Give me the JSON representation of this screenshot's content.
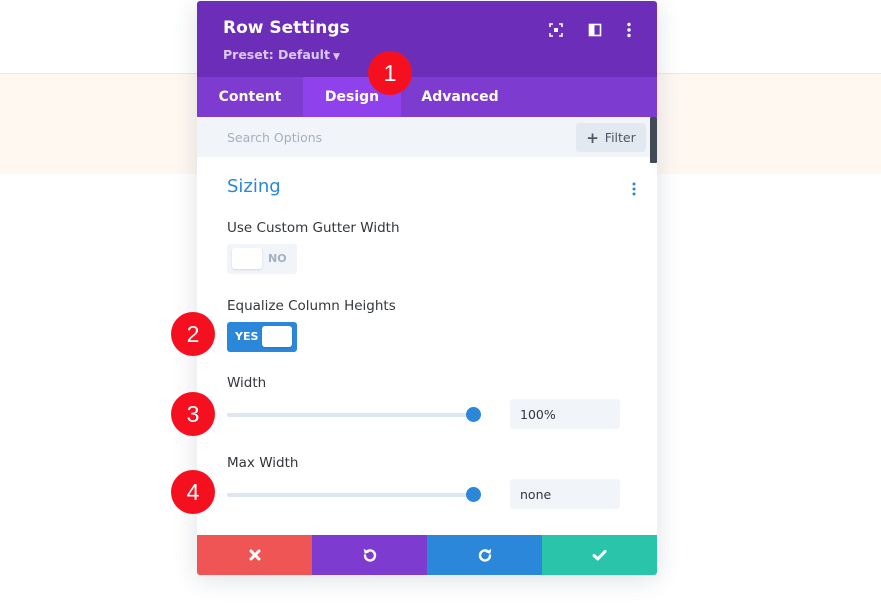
{
  "modal": {
    "title": "Row Settings",
    "preset": "Preset: Default",
    "icons": {
      "expand": "fullscreen-icon",
      "layout": "split-view-icon",
      "more": "kebab-menu-icon"
    }
  },
  "tabs": [
    {
      "label": "Content",
      "active": false
    },
    {
      "label": "Design",
      "active": true
    },
    {
      "label": "Advanced",
      "active": false
    }
  ],
  "search": {
    "placeholder": "Search Options",
    "filter_label": "Filter"
  },
  "section": {
    "title": "Sizing"
  },
  "fields": {
    "gutter": {
      "label": "Use Custom Gutter Width",
      "value": "NO",
      "on": false
    },
    "equalize": {
      "label": "Equalize Column Heights",
      "value": "YES",
      "on": true
    },
    "width": {
      "label": "Width",
      "value": "100%",
      "slider_fraction": 1.0
    },
    "max_width": {
      "label": "Max Width",
      "value": "none",
      "slider_fraction": 1.0
    }
  },
  "footer": {
    "cancel": {
      "icon": "close-icon",
      "color": "#ef5555"
    },
    "undo": {
      "icon": "undo-icon",
      "color": "#7e3bd0"
    },
    "redo": {
      "icon": "redo-icon",
      "color": "#2b87da"
    },
    "save": {
      "icon": "checkmark-icon",
      "color": "#29c4a9"
    }
  },
  "badges": [
    "1",
    "2",
    "3",
    "4"
  ],
  "colors": {
    "header": "#6c2eb9",
    "tabs": "#7e3bd0",
    "active_tab": "#8f42ec",
    "accent": "#2b87da",
    "badge": "#f5101f"
  }
}
